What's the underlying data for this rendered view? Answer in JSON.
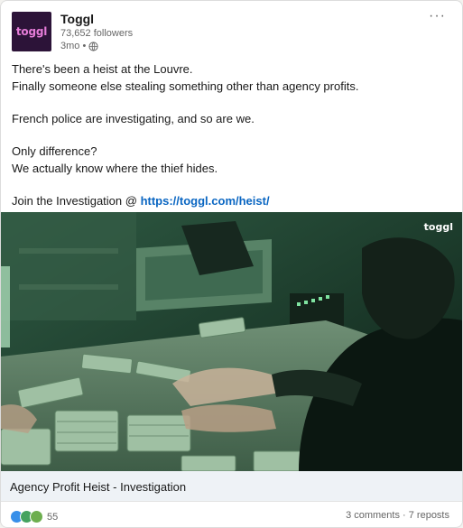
{
  "post": {
    "company_name": "Toggl",
    "logo_text": "toggl",
    "followers": "73,652 followers",
    "time": "3mo •",
    "more_label": "···",
    "lines": [
      "There's been a heist at the Louvre.",
      "Finally someone else stealing something other than agency profits.",
      "French police are investigating, and so are we.",
      "Only difference?",
      "We actually know where the thief hides.",
      "Join the Investigation @"
    ],
    "link_text": "https://toggl.com/heist/",
    "image_watermark": "toggl",
    "caption": "Agency Profit Heist - Investigation"
  },
  "footer": {
    "reaction_count": "55",
    "engagement": "3 comments · 7 reposts"
  },
  "colors": {
    "link": "#0a66c2",
    "logo_bg": "#2c1338",
    "logo_text": "#e57cd8",
    "image_tint": "#1f4d33"
  },
  "icons": [
    "globe-icon",
    "more-options-icon",
    "like-reaction-icon",
    "celebrate-reaction-icon",
    "support-reaction-icon"
  ]
}
